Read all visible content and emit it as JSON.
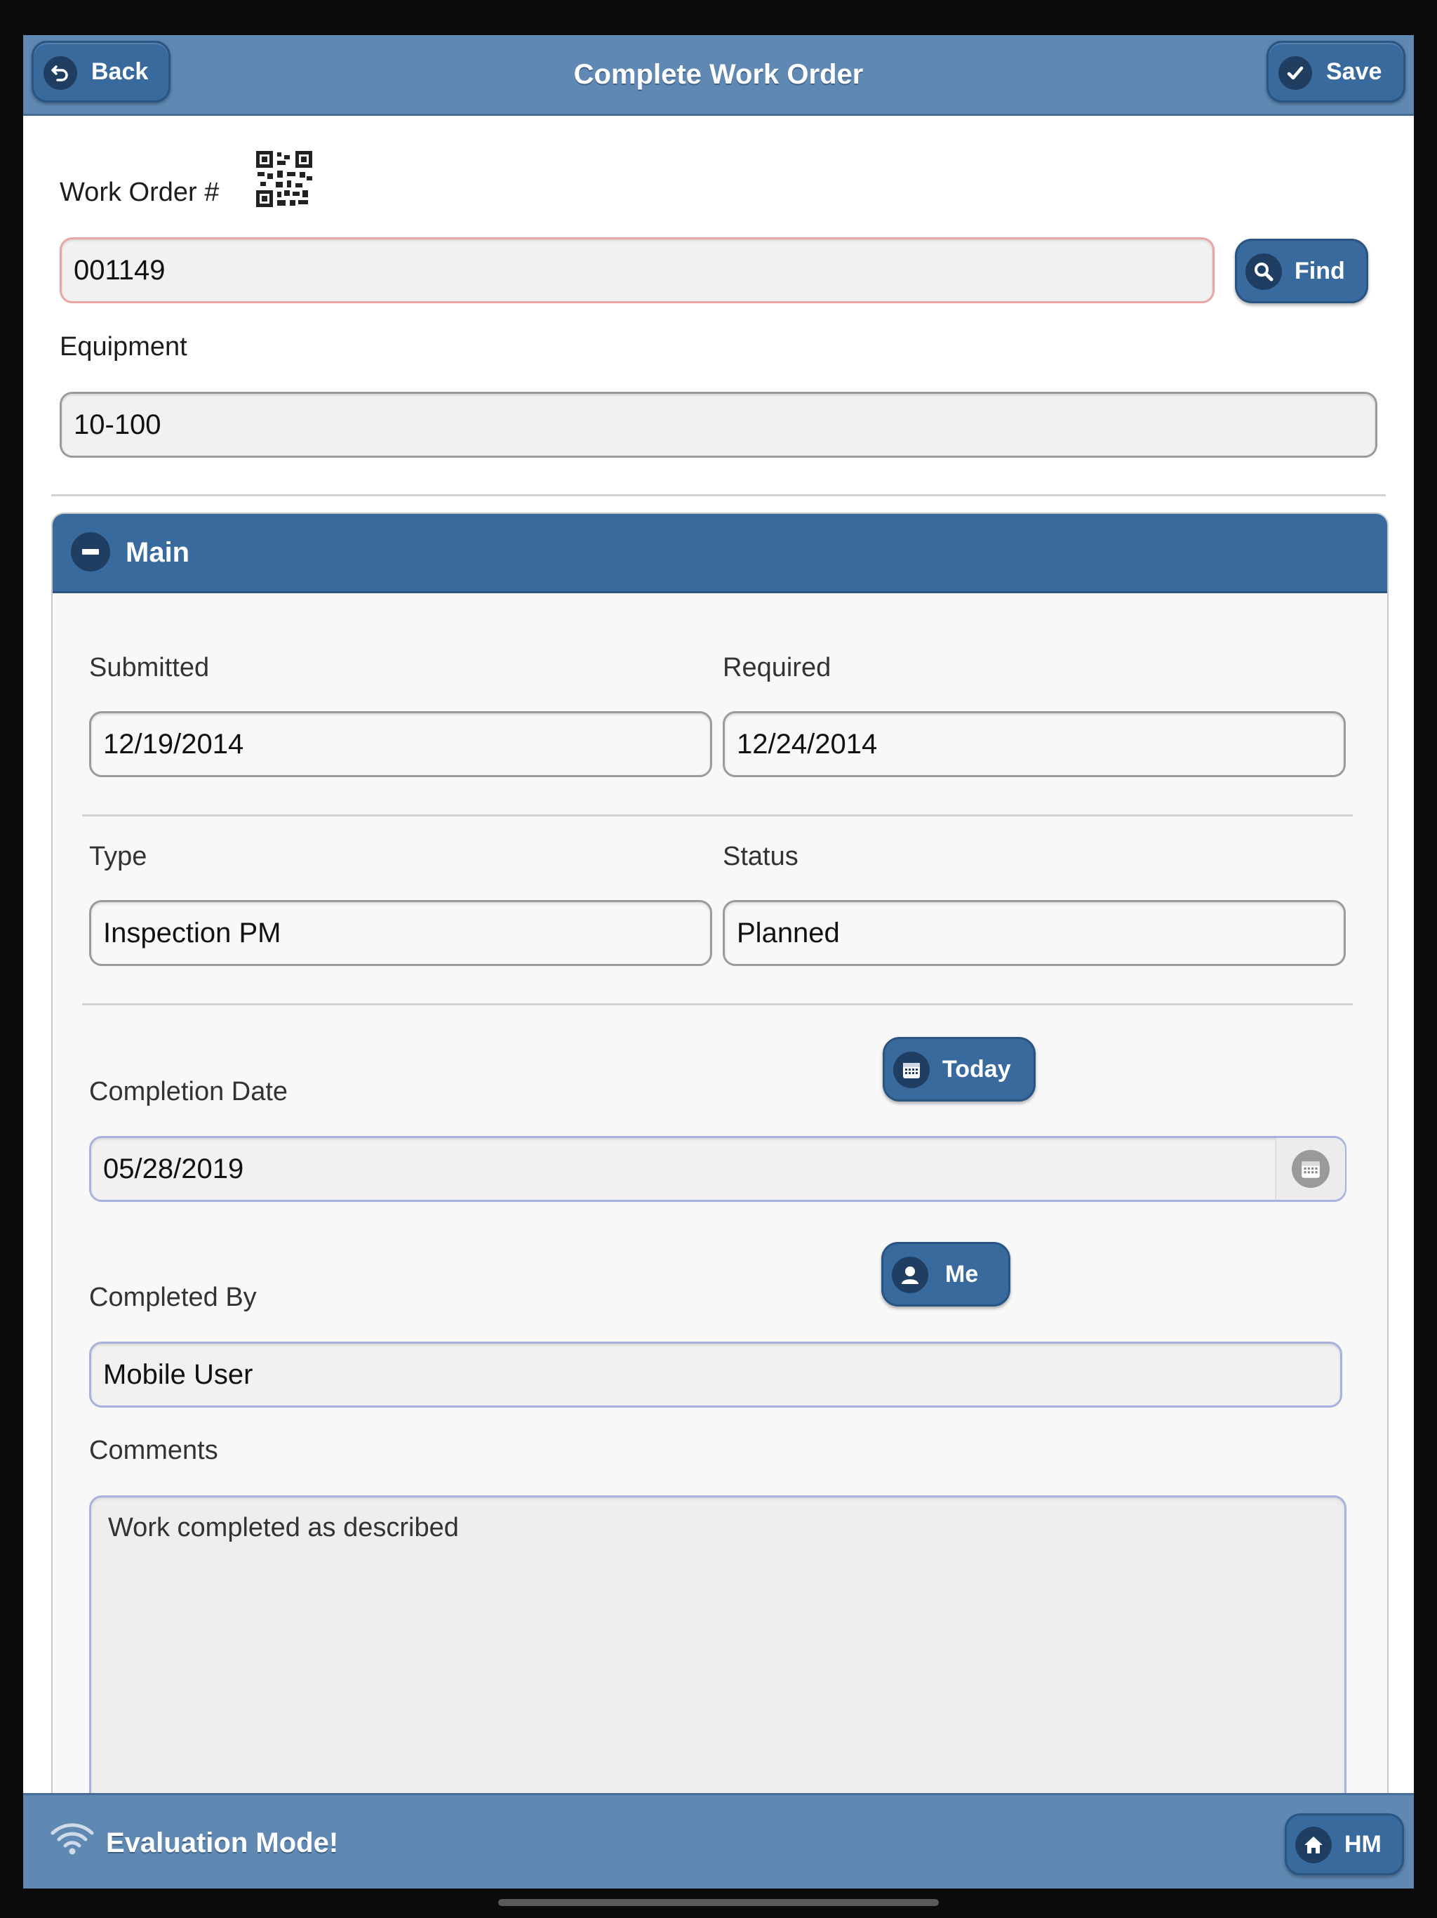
{
  "header": {
    "title": "Complete Work Order",
    "back_label": "Back",
    "save_label": "Save"
  },
  "work_order": {
    "label": "Work Order #",
    "value": "001149",
    "find_label": "Find"
  },
  "equipment": {
    "label": "Equipment",
    "value": "10-100"
  },
  "main_panel": {
    "title": "Main",
    "submitted": {
      "label": "Submitted",
      "value": "12/19/2014"
    },
    "required": {
      "label": "Required",
      "value": "12/24/2014"
    },
    "type": {
      "label": "Type",
      "value": "Inspection PM"
    },
    "status": {
      "label": "Status",
      "value": "Planned"
    },
    "completion_date": {
      "label": "Completion Date",
      "value": "05/28/2019",
      "today_label": "Today"
    },
    "completed_by": {
      "label": "Completed By",
      "value": "Mobile User",
      "me_label": "Me"
    },
    "comments": {
      "label": "Comments",
      "value": "Work completed as described"
    }
  },
  "footer": {
    "mode_text": "Evaluation Mode!",
    "home_label": "HM"
  },
  "colors": {
    "header_bg": "#5f88b3",
    "button_bg": "#386a9e",
    "icon_circle": "#1f3e62",
    "error_border": "#e9a5a5"
  }
}
